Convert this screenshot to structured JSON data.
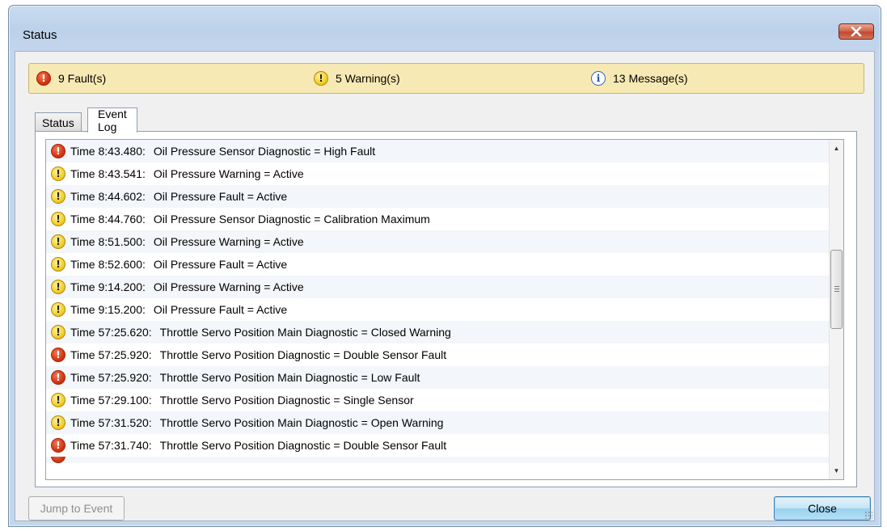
{
  "window": {
    "title": "Status",
    "close_icon": "close-x-icon"
  },
  "summary": {
    "faults": "9 Fault(s)",
    "warnings": "5 Warning(s)",
    "messages": "13 Message(s)"
  },
  "tabs": [
    {
      "label": "Status",
      "active": false
    },
    {
      "label": "Event Log",
      "active": true
    }
  ],
  "events": [
    {
      "type": "fault",
      "time": "Time 8:43.480:",
      "message": "Oil Pressure Sensor Diagnostic = High Fault"
    },
    {
      "type": "warning",
      "time": "Time 8:43.541:",
      "message": "Oil Pressure Warning = Active"
    },
    {
      "type": "warning",
      "time": "Time 8:44.602:",
      "message": "Oil Pressure Fault = Active"
    },
    {
      "type": "warning",
      "time": "Time 8:44.760:",
      "message": "Oil Pressure Sensor Diagnostic = Calibration Maximum"
    },
    {
      "type": "warning",
      "time": "Time 8:51.500:",
      "message": "Oil Pressure Warning = Active"
    },
    {
      "type": "warning",
      "time": "Time 8:52.600:",
      "message": "Oil Pressure Fault = Active"
    },
    {
      "type": "warning",
      "time": "Time 9:14.200:",
      "message": "Oil Pressure Warning = Active"
    },
    {
      "type": "warning",
      "time": "Time 9:15.200:",
      "message": "Oil Pressure Fault = Active"
    },
    {
      "type": "warning",
      "time": "Time 57:25.620:",
      "message": "Throttle Servo Position Main Diagnostic = Closed Warning"
    },
    {
      "type": "fault",
      "time": "Time 57:25.920:",
      "message": "Throttle Servo Position Diagnostic = Double Sensor Fault"
    },
    {
      "type": "fault",
      "time": "Time 57:25.920:",
      "message": "Throttle Servo Position Main Diagnostic = Low Fault"
    },
    {
      "type": "warning",
      "time": "Time 57:29.100:",
      "message": "Throttle Servo Position Diagnostic = Single Sensor"
    },
    {
      "type": "warning",
      "time": "Time 57:31.520:",
      "message": "Throttle Servo Position Main Diagnostic = Open Warning"
    },
    {
      "type": "fault",
      "time": "Time 57:31.740:",
      "message": "Throttle Servo Position Diagnostic = Double Sensor Fault"
    }
  ],
  "buttons": {
    "jump": "Jump to Event",
    "close": "Close"
  },
  "colors": {
    "summary_bg": "#f6e9b3",
    "fault": "#d23712",
    "warning": "#f3cf2a",
    "info": "#1f4fa8"
  }
}
